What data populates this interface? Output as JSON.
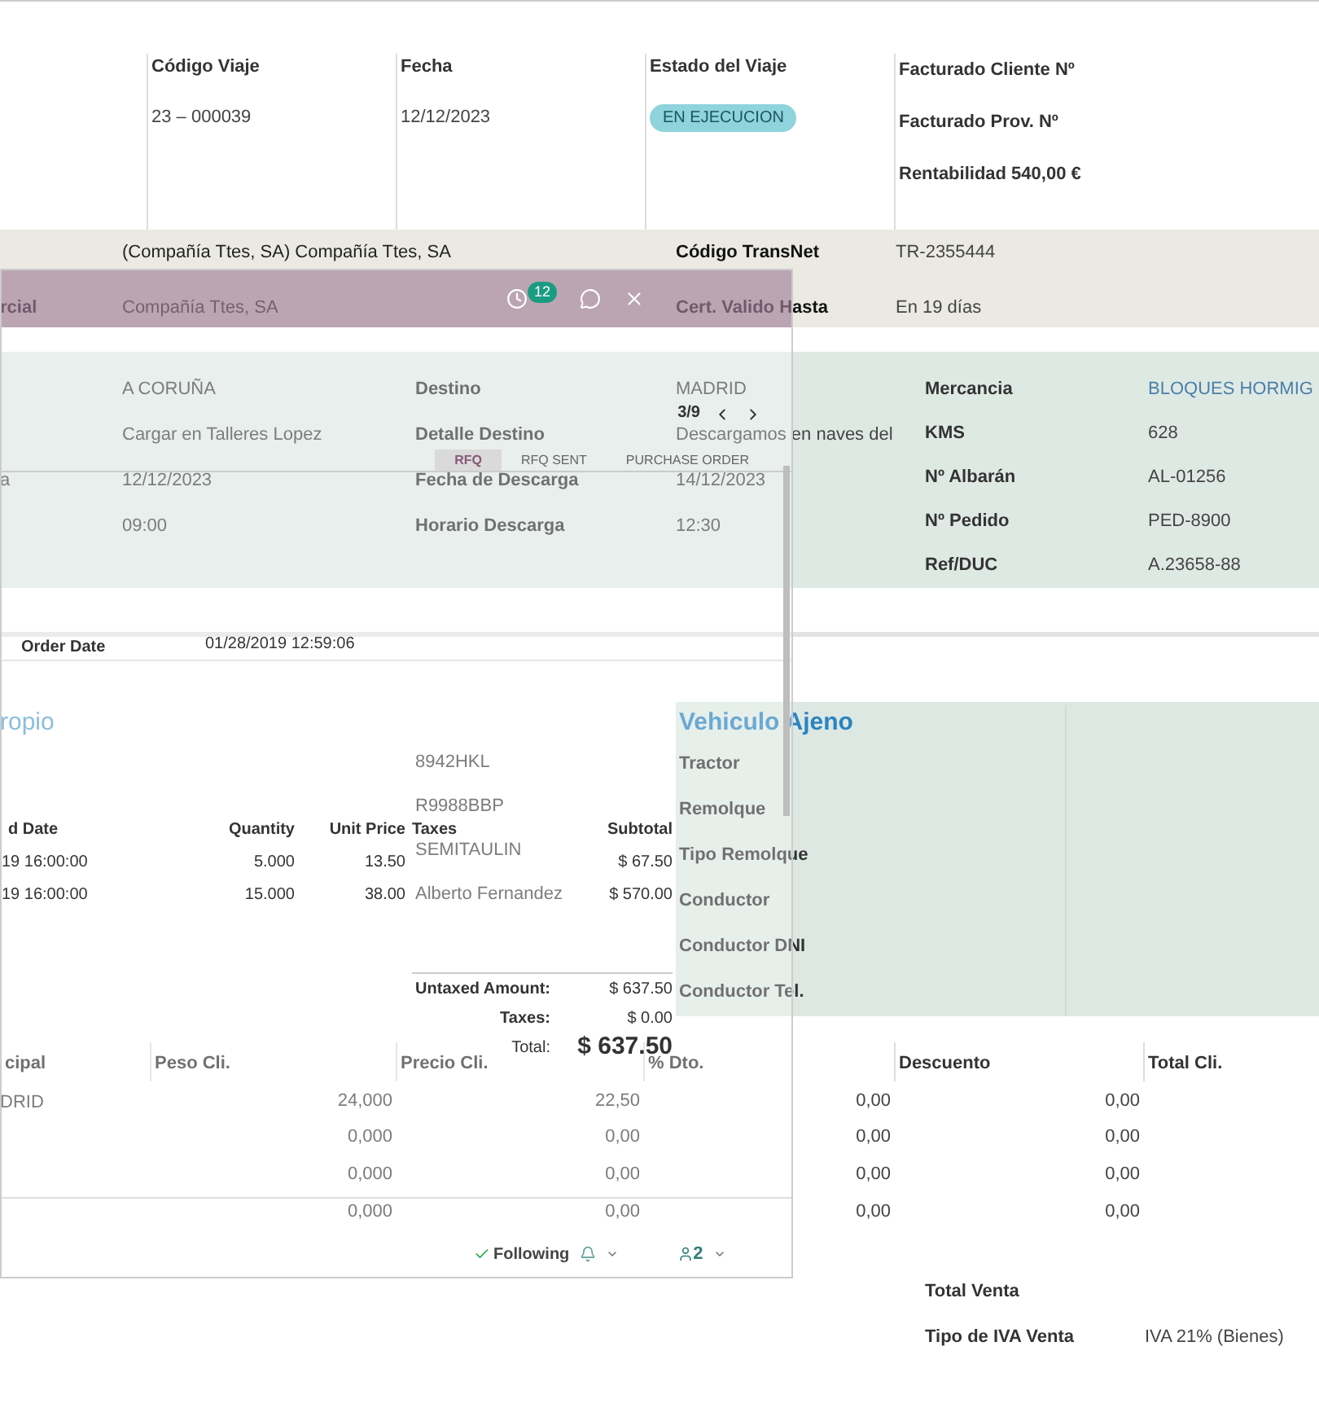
{
  "trip": {
    "header": [
      {
        "label": "Código Viaje",
        "value": "23 – 000039",
        "kind": "text"
      },
      {
        "label": "Fecha",
        "value": "12/12/2023",
        "kind": "text"
      },
      {
        "label": "Estado del Viaje",
        "value": "EN EJECUCION",
        "kind": "badge"
      }
    ],
    "invoice": [
      "Facturado Cliente Nº",
      "Facturado Prov. Nº",
      "Rentabilidad 540,00 €"
    ],
    "company": [
      {
        "value": "(Compañía Ttes, SA) Compañía Ttes, SA",
        "field": "Código TransNet",
        "field_value": "TR-2355444"
      },
      {
        "label": "rcial",
        "value": "Compañía Ttes, SA",
        "field": "Cert. Valido Hasta",
        "field_value": "En 19 días"
      }
    ],
    "origin": [
      {
        "value": "A CORUÑA"
      },
      {
        "value": "Cargar en Talleres Lopez"
      },
      {
        "label": "a",
        "value": "12/12/2023"
      },
      {
        "value": "09:00"
      }
    ],
    "destination": [
      {
        "label": "Destino",
        "value": "MADRID"
      },
      {
        "label": "Detalle Destino",
        "value": "Descargamos en naves del"
      },
      {
        "label": "Fecha de Descarga",
        "value": "14/12/2023"
      },
      {
        "label": "Horario Descarga",
        "value": "12:30"
      }
    ],
    "cargo": [
      {
        "label": "Mercancia",
        "value": "BLOQUES HORMIG",
        "kind": "link"
      },
      {
        "label": "KMS",
        "value": "628",
        "kind": "text"
      },
      {
        "label": "Nº Albarán",
        "value": "AL-01256",
        "kind": "text"
      },
      {
        "label": "Nº Pedido",
        "value": "PED-8900",
        "kind": "text"
      },
      {
        "label": "Ref/DUC",
        "value": "A.23658-88",
        "kind": "text"
      }
    ],
    "own_vehicle": {
      "title": "ropio",
      "values": [
        "8942HKL",
        "R9988BBP",
        "SEMITAULIN",
        "Alberto Fernandez"
      ]
    },
    "hired_vehicle": {
      "title": "Vehiculo Ajeno",
      "labels": [
        "Tractor",
        "Remolque",
        "Tipo Remolque",
        "Conductor",
        "Conductor DNI",
        "Conductor Tel."
      ]
    },
    "lines": {
      "columns": [
        "cipal",
        "Peso Cli.",
        "Precio Cli.",
        "% Dto.",
        "Descuento",
        "Total Cli."
      ],
      "rows": [
        {
          "column_1": "DRID",
          "peso": "24,000",
          "precio": "22,50",
          "dto": "0,00",
          "descuento": "0,00"
        },
        {
          "peso": "0,000",
          "precio": "0,00",
          "dto": "0,00",
          "descuento": "0,00"
        },
        {
          "peso": "0,000",
          "precio": "0,00",
          "dto": "0,00",
          "descuento": "0,00"
        },
        {
          "peso": "0,000",
          "precio": "0,00",
          "dto": "0,00",
          "descuento": "0,00"
        }
      ]
    },
    "totals": [
      {
        "label": "Total Venta"
      },
      {
        "label": "Tipo de IVA Venta",
        "value": "IVA 21% (Bienes)"
      }
    ]
  },
  "purchase_window": {
    "notifications": "12",
    "pager": "3/9",
    "stages": [
      {
        "label": "RFQ",
        "selected": true
      },
      {
        "label": "RFQ SENT",
        "selected": false
      },
      {
        "label": "PURCHASE ORDER",
        "selected": false
      }
    ],
    "order_date": {
      "label": "Order Date",
      "value": "01/28/2019 12:59:06"
    },
    "lines": {
      "columns": [
        "d Date",
        "Quantity",
        "Unit Price",
        "Taxes",
        "Subtotal"
      ],
      "rows": [
        {
          "date": "19 16:00:00",
          "quantity": "5.000",
          "unit_price": "13.50",
          "subtotal": "$ 67.50"
        },
        {
          "date": "19 16:00:00",
          "quantity": "15.000",
          "unit_price": "38.00",
          "subtotal": "$ 570.00"
        }
      ]
    },
    "totals": [
      {
        "label": "Untaxed Amount:",
        "value": "$ 637.50",
        "kind": "normal"
      },
      {
        "label": "Taxes:",
        "value": "$ 0.00",
        "kind": "normal"
      },
      {
        "label": "Total:",
        "value": "$ 637.50",
        "kind": "grand"
      }
    ],
    "following": "Following",
    "followers": "2"
  }
}
